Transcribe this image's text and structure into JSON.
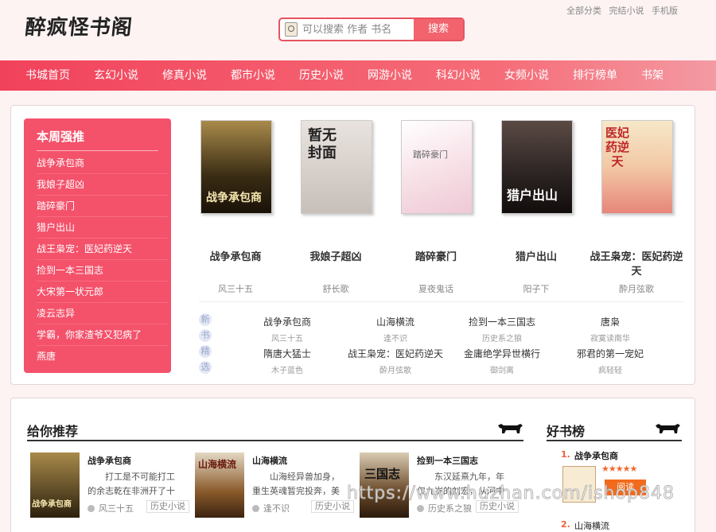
{
  "header": {
    "logo": "醉疯怪书阁",
    "search_placeholder": "可以搜索 作者 书名",
    "search_button": "搜索",
    "top_links": [
      "全部分类",
      "完结小说",
      "手机版"
    ]
  },
  "nav": {
    "items": [
      "书城首页",
      "玄幻小说",
      "修真小说",
      "都市小说",
      "历史小说",
      "网游小说",
      "科幻小说",
      "女频小说",
      "排行榜单",
      "书架"
    ]
  },
  "weekly": {
    "title": "本周强推",
    "items": [
      "战争承包商",
      "我娘子超凶",
      "踏碎豪门",
      "猎户出山",
      "战王枭宠：医妃药逆天",
      "捡到一本三国志",
      "大宋第一状元郎",
      "凌云志异",
      "学霸，你家渣爷又犯病了",
      "燕唐"
    ]
  },
  "featured": [
    {
      "title": "战争承包商",
      "author": "风三十五",
      "cover_text": "战争承包商"
    },
    {
      "title": "我娘子超凶",
      "author": "舒长歌",
      "cover_text": "暂无封面"
    },
    {
      "title": "踏碎豪门",
      "author": "夏夜鬼话",
      "cover_text": "踏碎豪门"
    },
    {
      "title": "猎户出山",
      "author": "阳子下",
      "cover_text": "猎户出山"
    },
    {
      "title": "战王枭宠：医妃药逆天",
      "author": "酔月弦歌",
      "cover_text": "医妃药逆天"
    }
  ],
  "new_picks": {
    "label": [
      "新",
      "书",
      "精",
      "选"
    ],
    "items": [
      {
        "title": "战争承包商",
        "author": "风三十五"
      },
      {
        "title": "山海横流",
        "author": "逢不识"
      },
      {
        "title": "捡到一本三国志",
        "author": "历史系之狼"
      },
      {
        "title": "唐枭",
        "author": "寂寞读南华"
      },
      {
        "title": "隋唐大猛士",
        "author": "木子蓝色"
      },
      {
        "title": "战王枭宠：医妃药逆天",
        "author": "酔月弦歌"
      },
      {
        "title": "金庸绝学异世横行",
        "author": "御剑离"
      },
      {
        "title": "邪君的第一宠妃",
        "author": "疯轻轻"
      }
    ]
  },
  "recommend": {
    "title": "给你推荐",
    "items": [
      {
        "title": "战争承包商",
        "desc": "打工是不可能打工的余志乾在非洲开了十家皮包公司",
        "author": "风三十五",
        "tag": "历史小说",
        "cover_text": "战争承包商"
      },
      {
        "title": "山海横流",
        "desc": "山海经异兽加身，重生英魂暂完投奔，美人在怀，",
        "author": "逢不识",
        "tag": "历史小说",
        "cover_text": "山海横流"
      },
      {
        "title": "捡到一本三国志",
        "desc": "东汉延熹九年，年仅九岁的刘宏，从河中捡起一只",
        "author": "历史系之狼",
        "tag": "历史小说",
        "cover_text": "三国志"
      }
    ]
  },
  "ranking": {
    "title": "好书榜",
    "items": [
      {
        "num": "1.",
        "title": "战争承包商",
        "stars": "★★★★★",
        "read": "阅读"
      },
      {
        "num": "2.",
        "title": "山海横流"
      }
    ]
  },
  "watermark": "https://www.huzhan.com/ishop848",
  "colors": {
    "accent": "#f2425b",
    "sidebar": "#f4516a",
    "read_button": "#f26b1d"
  }
}
